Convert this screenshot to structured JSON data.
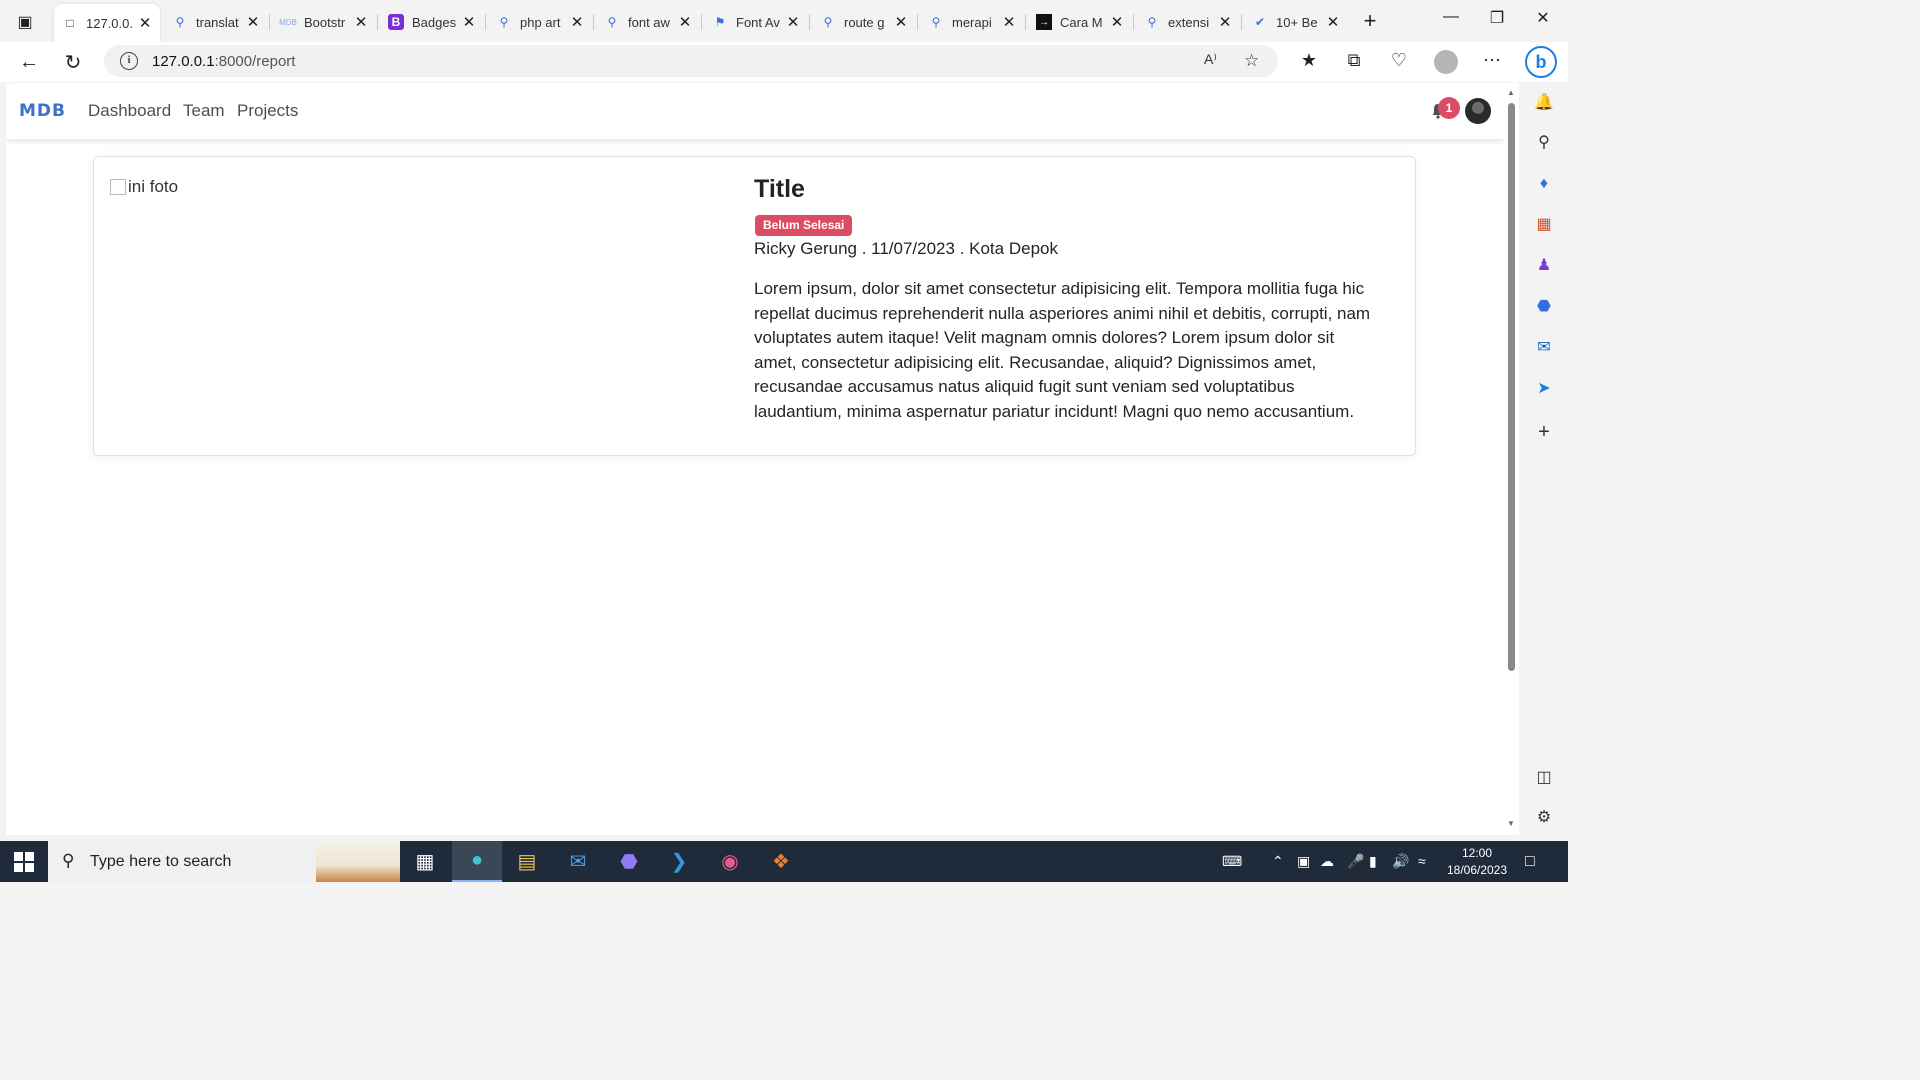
{
  "browser": {
    "tabs": [
      {
        "label": "127.0.0.",
        "icon": "page-icon",
        "active": true
      },
      {
        "label": "translat",
        "icon": "search-icon"
      },
      {
        "label": "Bootstr",
        "icon": "mdb-icon"
      },
      {
        "label": "Badges",
        "icon": "bootstrap-icon"
      },
      {
        "label": "php art",
        "icon": "search-icon"
      },
      {
        "label": "font aw",
        "icon": "search-icon"
      },
      {
        "label": "Font Av",
        "icon": "flag-icon"
      },
      {
        "label": "route g",
        "icon": "search-icon"
      },
      {
        "label": "merapi",
        "icon": "search-icon"
      },
      {
        "label": "Cara M",
        "icon": "site-icon"
      },
      {
        "label": "extensi",
        "icon": "search-icon"
      },
      {
        "label": "10+ Be",
        "icon": "check-icon"
      }
    ],
    "url_host": "127.0.0.1",
    "url_path": ":8000/report"
  },
  "app": {
    "brand": "MDB",
    "nav": [
      "Dashboard",
      "Team",
      "Projects"
    ],
    "notification_count": "1"
  },
  "report": {
    "image_alt": "ini foto",
    "title": "Title",
    "status": "Belum Selesai",
    "meta": "Ricky Gerung . 11/07/2023 . Kota Depok",
    "description": "Lorem ipsum, dolor sit amet consectetur adipisicing elit. Tempora mollitia fuga hic repellat ducimus reprehenderit nulla asperiores animi nihil et debitis, corrupti, nam voluptates autem itaque! Velit magnam omnis dolores? Lorem ipsum dolor sit amet, consectetur adipisicing elit. Recusandae, aliquid? Dignissimos amet, recusandae accusamus natus aliquid fugit sunt veniam sed voluptatibus laudantium, minima aspernatur pariatur incidunt! Magni quo nemo accusantium."
  },
  "taskbar": {
    "search_placeholder": "Type here to search",
    "time": "12:00",
    "date": "18/06/2023"
  },
  "colors": {
    "brand": "#3b71ca",
    "badge_danger": "#dc4c64"
  }
}
